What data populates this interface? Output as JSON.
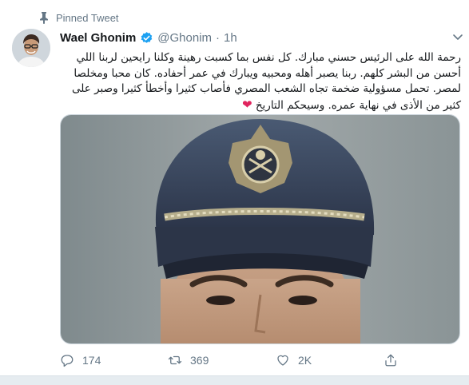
{
  "pinned_label": "Pinned Tweet",
  "author": {
    "name": "Wael Ghonim",
    "handle": "@Ghonim",
    "separator": "·",
    "time": "1h"
  },
  "tweet_text": "رحمة الله على الرئيس حسني مبارك. كل نفس بما كسبت رهينة وكلنا رايحين لربنا اللي أحسن من البشر كلهم. ربنا يصبر أهله ومحبيه ويبارك في عمر أحفاده. كان محبا ومخلصا لمصر. تحمل مسؤولية ضخمة تجاه الشعب المصري فأصاب كثيرا وأخطأ كثيرا وصبر على كثير من الأذى في نهاية عمره. وسيحكم التاريخ",
  "tweet_emoji": "❤",
  "actions": {
    "replies": "174",
    "retweets": "369",
    "likes": "2K"
  },
  "icons": {
    "pinned": "pin-icon",
    "verified": "verified-badge-icon",
    "more": "chevron-down-icon",
    "reply": "reply-icon",
    "retweet": "retweet-icon",
    "like": "heart-icon",
    "share": "share-icon"
  },
  "colors": {
    "accent": "#1da1f2",
    "muted": "#657786",
    "heart": "#e0245e"
  }
}
